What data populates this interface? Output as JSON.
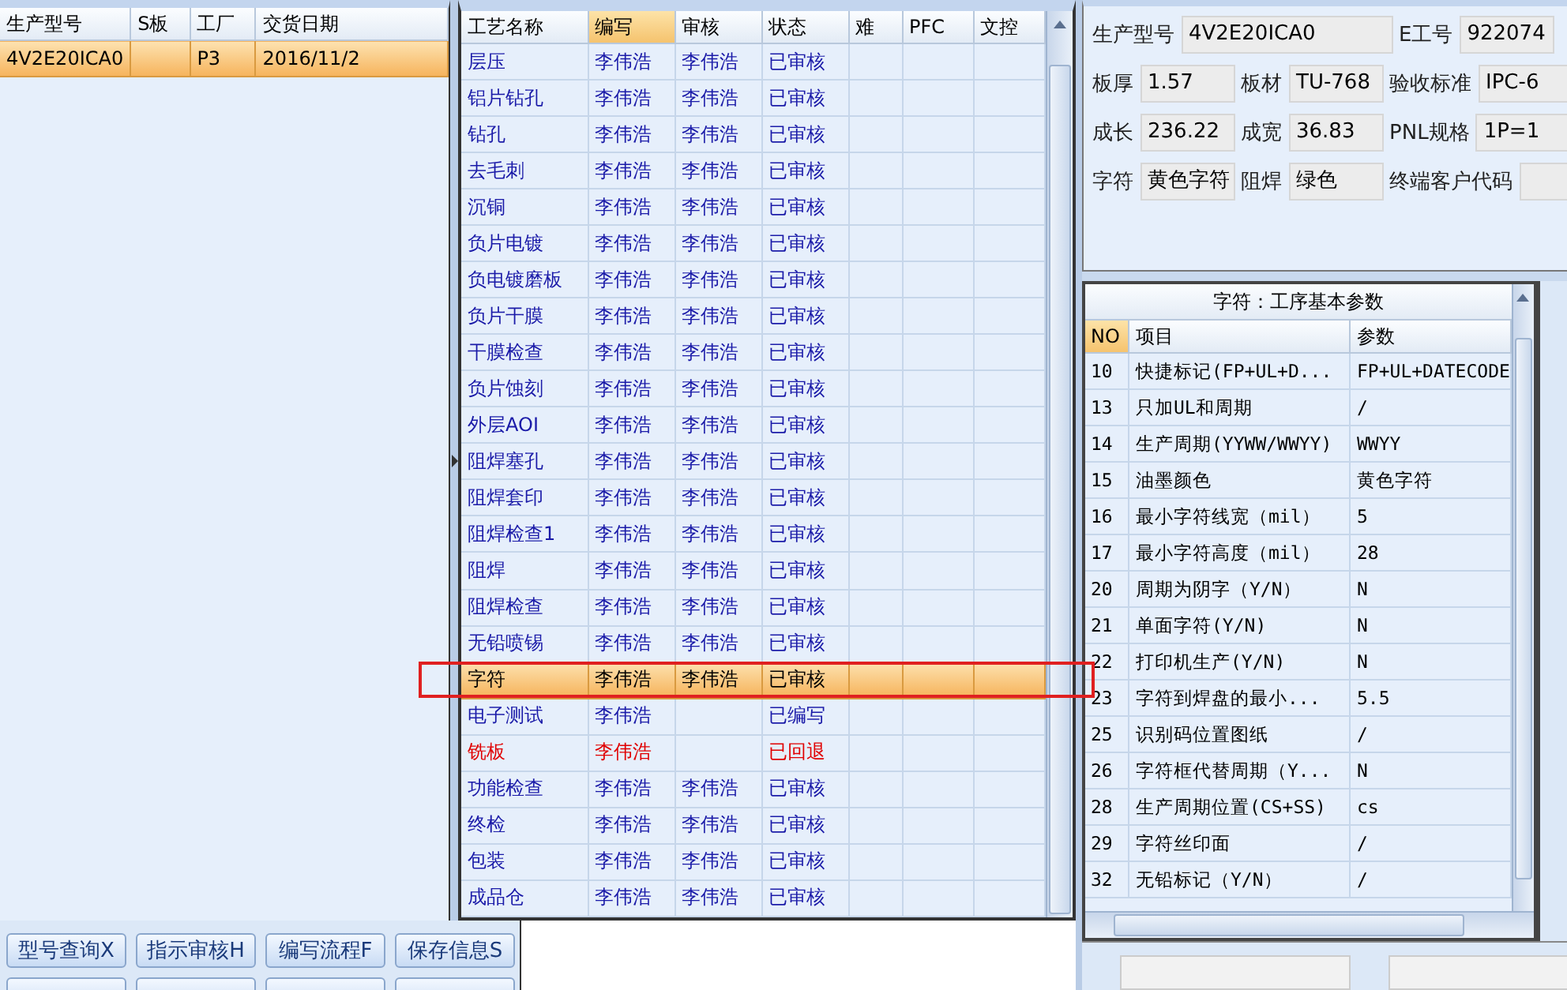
{
  "models_table": {
    "columns": [
      "生产型号",
      "S板",
      "工厂",
      "交货日期"
    ],
    "rows": [
      {
        "cells": [
          "4V2E20ICA0",
          "",
          "P3",
          "2016/11/2"
        ],
        "selected": true
      }
    ]
  },
  "process_table": {
    "columns": [
      {
        "label": "工艺名称",
        "selected": false
      },
      {
        "label": "编写",
        "selected": true
      },
      {
        "label": "审核",
        "selected": false
      },
      {
        "label": "状态",
        "selected": false
      },
      {
        "label": "难",
        "selected": false
      },
      {
        "label": "PFC",
        "selected": false
      },
      {
        "label": "文控",
        "selected": false
      }
    ],
    "rows": [
      {
        "name": "层压",
        "writer": "李伟浩",
        "reviewer": "李伟浩",
        "status": "已审核",
        "kind": "normal",
        "selected": false
      },
      {
        "name": "铝片钻孔",
        "writer": "李伟浩",
        "reviewer": "李伟浩",
        "status": "已审核",
        "kind": "normal",
        "selected": false
      },
      {
        "name": "钻孔",
        "writer": "李伟浩",
        "reviewer": "李伟浩",
        "status": "已审核",
        "kind": "normal",
        "selected": false
      },
      {
        "name": "去毛刺",
        "writer": "李伟浩",
        "reviewer": "李伟浩",
        "status": "已审核",
        "kind": "normal",
        "selected": false
      },
      {
        "name": "沉铜",
        "writer": "李伟浩",
        "reviewer": "李伟浩",
        "status": "已审核",
        "kind": "normal",
        "selected": false
      },
      {
        "name": "负片电镀",
        "writer": "李伟浩",
        "reviewer": "李伟浩",
        "status": "已审核",
        "kind": "normal",
        "selected": false
      },
      {
        "name": "负电镀磨板",
        "writer": "李伟浩",
        "reviewer": "李伟浩",
        "status": "已审核",
        "kind": "normal",
        "selected": false
      },
      {
        "name": "负片干膜",
        "writer": "李伟浩",
        "reviewer": "李伟浩",
        "status": "已审核",
        "kind": "normal",
        "selected": false
      },
      {
        "name": "干膜检查",
        "writer": "李伟浩",
        "reviewer": "李伟浩",
        "status": "已审核",
        "kind": "normal",
        "selected": false
      },
      {
        "name": "负片蚀刻",
        "writer": "李伟浩",
        "reviewer": "李伟浩",
        "status": "已审核",
        "kind": "normal",
        "selected": false
      },
      {
        "name": "外层AOI",
        "writer": "李伟浩",
        "reviewer": "李伟浩",
        "status": "已审核",
        "kind": "normal",
        "selected": false
      },
      {
        "name": "阻焊塞孔",
        "writer": "李伟浩",
        "reviewer": "李伟浩",
        "status": "已审核",
        "kind": "normal",
        "selected": false
      },
      {
        "name": "阻焊套印",
        "writer": "李伟浩",
        "reviewer": "李伟浩",
        "status": "已审核",
        "kind": "normal",
        "selected": false
      },
      {
        "name": "阻焊检查1",
        "writer": "李伟浩",
        "reviewer": "李伟浩",
        "status": "已审核",
        "kind": "normal",
        "selected": false
      },
      {
        "name": "阻焊",
        "writer": "李伟浩",
        "reviewer": "李伟浩",
        "status": "已审核",
        "kind": "normal",
        "selected": false
      },
      {
        "name": "阻焊检查",
        "writer": "李伟浩",
        "reviewer": "李伟浩",
        "status": "已审核",
        "kind": "normal",
        "selected": false
      },
      {
        "name": "无铅喷锡",
        "writer": "李伟浩",
        "reviewer": "李伟浩",
        "status": "已审核",
        "kind": "normal",
        "selected": false
      },
      {
        "name": "字符",
        "writer": "李伟浩",
        "reviewer": "李伟浩",
        "status": "已审核",
        "kind": "normal",
        "selected": true
      },
      {
        "name": "电子测试",
        "writer": "李伟浩",
        "reviewer": "",
        "status": "已编写",
        "kind": "normal",
        "selected": false
      },
      {
        "name": "铣板",
        "writer": "李伟浩",
        "reviewer": "",
        "status": "已回退",
        "kind": "rejected",
        "selected": false
      },
      {
        "name": "功能检查",
        "writer": "李伟浩",
        "reviewer": "李伟浩",
        "status": "已审核",
        "kind": "normal",
        "selected": false
      },
      {
        "name": "终检",
        "writer": "李伟浩",
        "reviewer": "李伟浩",
        "status": "已审核",
        "kind": "normal",
        "selected": false
      },
      {
        "name": "包装",
        "writer": "李伟浩",
        "reviewer": "李伟浩",
        "status": "已审核",
        "kind": "normal",
        "selected": false
      },
      {
        "name": "成品仓",
        "writer": "李伟浩",
        "reviewer": "李伟浩",
        "status": "已审核",
        "kind": "normal",
        "selected": false
      }
    ]
  },
  "buttons": [
    "型号查询X",
    "指示审核H",
    "编写流程F",
    "保存信息S"
  ],
  "info_fields": [
    [
      {
        "label": "生产型号",
        "value": "4V2E20ICA0"
      },
      {
        "label": "E工号",
        "value": "922074"
      }
    ],
    [
      {
        "label": "板厚",
        "value": "1.57"
      },
      {
        "label": "板材",
        "value": "TU-768"
      },
      {
        "label": "验收标准",
        "value": "IPC-6"
      }
    ],
    [
      {
        "label": "成长",
        "value": "236.22"
      },
      {
        "label": "成宽",
        "value": "36.83"
      },
      {
        "label": "PNL规格",
        "value": "1P=1"
      }
    ],
    [
      {
        "label": "字符",
        "value": "黄色字符"
      },
      {
        "label": "阻焊",
        "value": "绿色"
      },
      {
        "label": "终端客户代码"
      }
    ]
  ],
  "params_table": {
    "title": "字符：工序基本参数",
    "columns": [
      "NO",
      "项目",
      "参数"
    ],
    "rows": [
      [
        "10",
        "快捷标记(FP+UL+D...",
        "FP+UL+DATECODE"
      ],
      [
        "13",
        "只加UL和周期",
        "/"
      ],
      [
        "14",
        "生产周期(YYWW/WWYY)",
        "WWYY"
      ],
      [
        "15",
        "油墨颜色",
        "黄色字符"
      ],
      [
        "16",
        "最小字符线宽（mil）",
        "5"
      ],
      [
        "17",
        "最小字符高度（mil）",
        "28"
      ],
      [
        "20",
        "周期为阴字（Y/N）",
        "N"
      ],
      [
        "21",
        "单面字符(Y/N)",
        "N"
      ],
      [
        "22",
        "打印机生产(Y/N)",
        "N"
      ],
      [
        "23",
        "字符到焊盘的最小...",
        "5.5"
      ],
      [
        "25",
        "识别码位置图纸",
        "/"
      ],
      [
        "26",
        "字符框代替周期（Y...",
        "N"
      ],
      [
        "28",
        "生产周期位置(CS+SS)",
        "cs"
      ],
      [
        "29",
        "字符丝印面",
        "/"
      ],
      [
        "32",
        "无铅标记（Y/N）",
        "/"
      ]
    ]
  }
}
